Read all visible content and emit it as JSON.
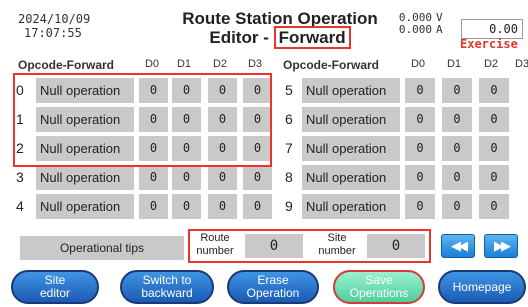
{
  "header": {
    "date": "2024/10/09",
    "time": "17:07:55",
    "title_line1": "Route Station Operation",
    "title_line2_prefix": "Editor - ",
    "direction": "Forward",
    "voltage": "0.000",
    "voltage_unit": "V",
    "current": "0.000",
    "current_unit": "A",
    "value_display": "0.00",
    "mode": "Exercise"
  },
  "table": {
    "opcode_header": "Opcode-Forward",
    "d_headers": [
      "D0",
      "D1",
      "D2",
      "D3"
    ],
    "left_rows": [
      {
        "index": "0",
        "op": "Null operation",
        "d": [
          "0",
          "0",
          "0",
          "0"
        ]
      },
      {
        "index": "1",
        "op": "Null operation",
        "d": [
          "0",
          "0",
          "0",
          "0"
        ]
      },
      {
        "index": "2",
        "op": "Null operation",
        "d": [
          "0",
          "0",
          "0",
          "0"
        ]
      },
      {
        "index": "3",
        "op": "Null operation",
        "d": [
          "0",
          "0",
          "0",
          "0"
        ]
      },
      {
        "index": "4",
        "op": "Null operation",
        "d": [
          "0",
          "0",
          "0",
          "0"
        ]
      }
    ],
    "right_rows": [
      {
        "index": "5",
        "op": "Null operation",
        "d": [
          "0",
          "0",
          "0"
        ]
      },
      {
        "index": "6",
        "op": "Null operation",
        "d": [
          "0",
          "0",
          "0"
        ]
      },
      {
        "index": "7",
        "op": "Null operation",
        "d": [
          "0",
          "0",
          "0"
        ]
      },
      {
        "index": "8",
        "op": "Null operation",
        "d": [
          "0",
          "0",
          "0"
        ]
      },
      {
        "index": "9",
        "op": "Null operation",
        "d": [
          "0",
          "0",
          "0"
        ]
      }
    ]
  },
  "footer": {
    "tips": "Operational tips",
    "route_label_1": "Route",
    "route_label_2": "number",
    "route_value": "0",
    "site_label_1": "Site",
    "site_label_2": "number",
    "site_value": "0",
    "prev_glyph": "◀◀",
    "next_glyph": "▶▶"
  },
  "buttons": {
    "site_editor_1": "Site",
    "site_editor_2": "editor",
    "switch_1": "Switch to",
    "switch_2": "backward",
    "erase_1": "Erase",
    "erase_2": "Operation",
    "save_1": "Save",
    "save_2": "Operations",
    "homepage": "Homepage"
  }
}
